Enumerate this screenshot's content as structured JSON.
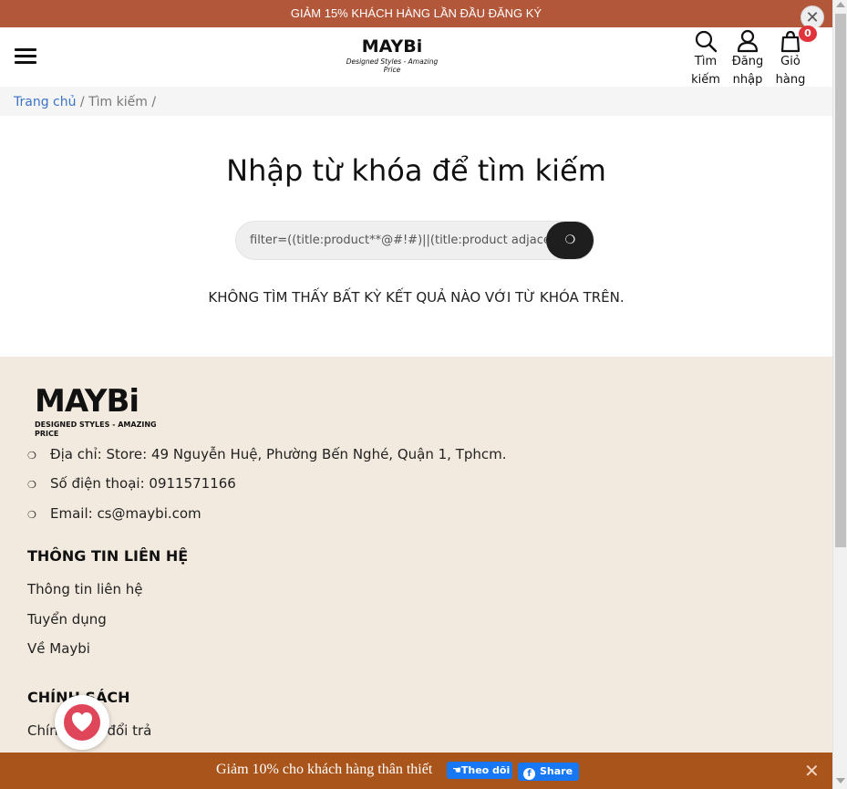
{
  "promo": {
    "text": "GIẢM 15% KHÁCH HÀNG LẦN ĐẦU ĐĂNG KÝ",
    "close": "✕"
  },
  "header": {
    "logo_word": "MAYBi",
    "logo_tagline": "Designed Styles - Amazing Price",
    "search_line1": "Tìm",
    "search_line2": "kiếm",
    "login_line1": "Đăng",
    "login_line2": "nhập",
    "cart_line1": "Giỏ",
    "cart_line2": "hàng",
    "cart_count": "0"
  },
  "breadcrumb": {
    "home": "Trang chủ",
    "sep1": " / ",
    "current": "Tìm kiếm",
    "sep2": " /"
  },
  "search": {
    "title": "Nhập từ khóa để tìm kiếm",
    "query": "filter=((title:product**@#!#)||(title:product adjacent",
    "button_glyph": "❍",
    "no_result": "KHÔNG TÌM THẤY BẤT KỲ KẾT QUẢ NÀO VỚI TỪ KHÓA TRÊN."
  },
  "footer": {
    "logo_word": "MAYBi",
    "logo_tagline": "DESIGNED STYLES - AMAZING PRICE",
    "bullet": "❍",
    "address": "Địa chỉ: Store: 49 Nguyễn Huệ, Phường Bến Nghé, Quận 1, Tphcm.",
    "phone": "Số điện thoại: 0911571166",
    "email": "Email: cs@maybi.com",
    "contact_heading": "THÔNG TIN LIÊN HỆ",
    "contact_links": [
      "Thông tin liên hệ",
      "Tuyển dụng",
      "Về Maybi"
    ],
    "policy_heading": "CHÍNH SÁCH",
    "policy_links": [
      "Chính sách đổi trả"
    ]
  },
  "bottom_bar": {
    "text": "Giảm 10% cho khách hàng thân thiết",
    "follow": "Theo dõi",
    "share": "Share",
    "close": "✕"
  },
  "colors": {
    "promo_bg": "#b3573a",
    "footer_bg": "#f3eadf",
    "bottom_bar_bg": "#a9541b",
    "link_blue": "#3b73c7",
    "facebook_blue": "#1877f2",
    "badge_red": "#e0333b",
    "heart_red": "#e0465a"
  }
}
